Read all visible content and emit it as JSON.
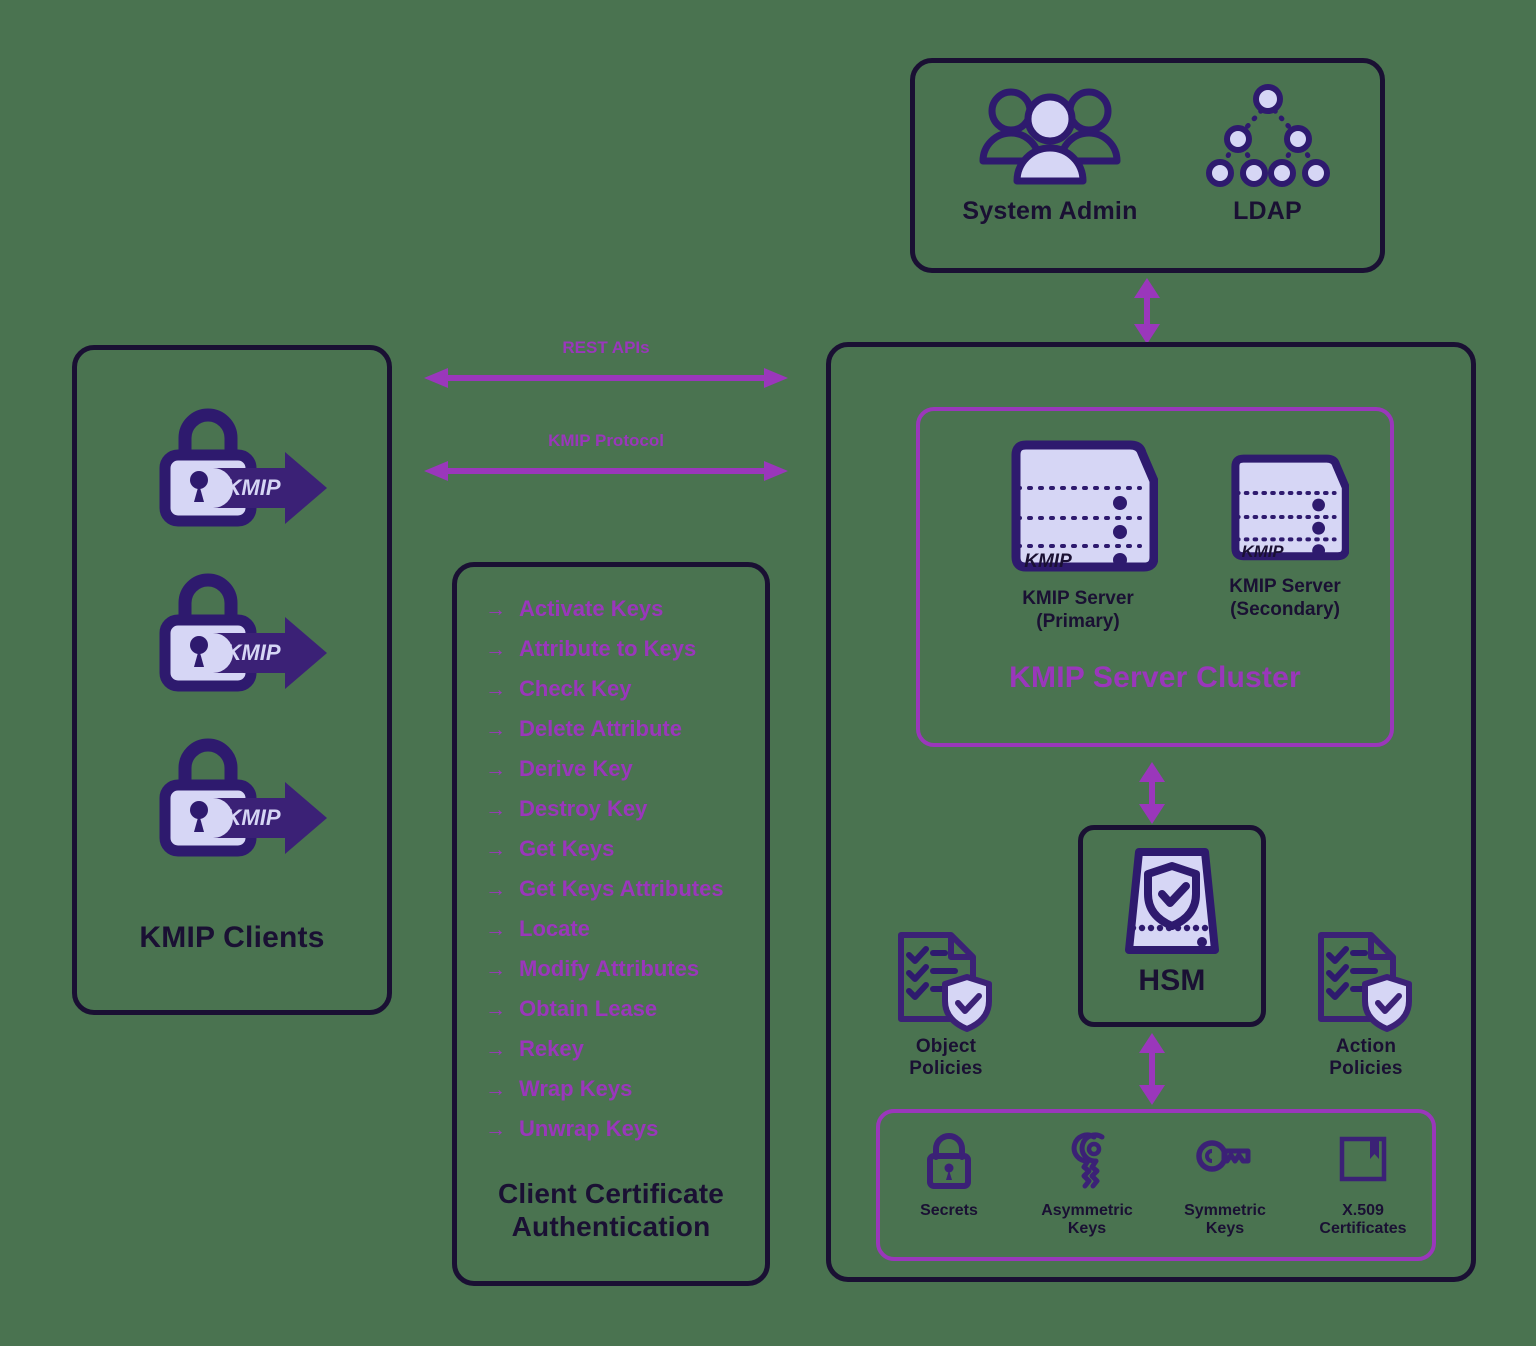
{
  "diagram": {
    "title": "KMIP Key Management Architecture",
    "background_color": "#4a7350",
    "accent_purple": "#9a37bb",
    "dark_navy": "#1a1033",
    "icon_navy": "#2e1a6e",
    "icon_fill": "#d6d6f5"
  },
  "clients_panel": {
    "label": "KMIP Clients",
    "client_badge": "KMIP",
    "client_count": 3
  },
  "connectors": {
    "rest": "REST APIs",
    "kmip": "KMIP Protocol"
  },
  "operations_panel": {
    "title_line1": "Client Certificate",
    "title_line2": "Authentication",
    "bullet": "→",
    "items": [
      "Activate Keys",
      "Attribute to Keys",
      "Check Key",
      "Delete Attribute",
      "Derive Key",
      "Destroy Key",
      "Get Keys",
      "Get Keys Attributes",
      "Locate",
      "Modify Attributes",
      "Obtain Lease",
      "Rekey",
      "Wrap Keys",
      "Unwrap Keys"
    ]
  },
  "admin_panel": {
    "items": [
      {
        "label": "System Admin",
        "icon": "users-icon"
      },
      {
        "label": "LDAP",
        "icon": "tree-hierarchy-icon"
      }
    ]
  },
  "server_panel": {
    "cluster": {
      "label": "KMIP Server Cluster",
      "servers": [
        {
          "badge": "KMIP",
          "line1": "KMIP Server",
          "line2": "(Primary)",
          "size": "large"
        },
        {
          "badge": "KMIP",
          "line1": "KMIP Server",
          "line2": "(Secondary)",
          "size": "small"
        }
      ]
    },
    "hsm": {
      "label": "HSM",
      "icon": "hsm-shield-icon"
    },
    "policies": [
      {
        "line1": "Object",
        "line2": "Policies",
        "icon": "document-check-shield-icon",
        "side": "left"
      },
      {
        "line1": "Action",
        "line2": "Policies",
        "icon": "document-check-shield-icon",
        "side": "right"
      }
    ],
    "objects": [
      {
        "line1": "Secrets",
        "line2": "",
        "icon": "padlock-icon"
      },
      {
        "line1": "Asymmetric",
        "line2": "Keys",
        "icon": "key-pair-icon"
      },
      {
        "line1": "Symmetric",
        "line2": "Keys",
        "icon": "single-key-icon"
      },
      {
        "line1": "X.509",
        "line2": "Certificates",
        "icon": "certificate-icon"
      }
    ]
  }
}
